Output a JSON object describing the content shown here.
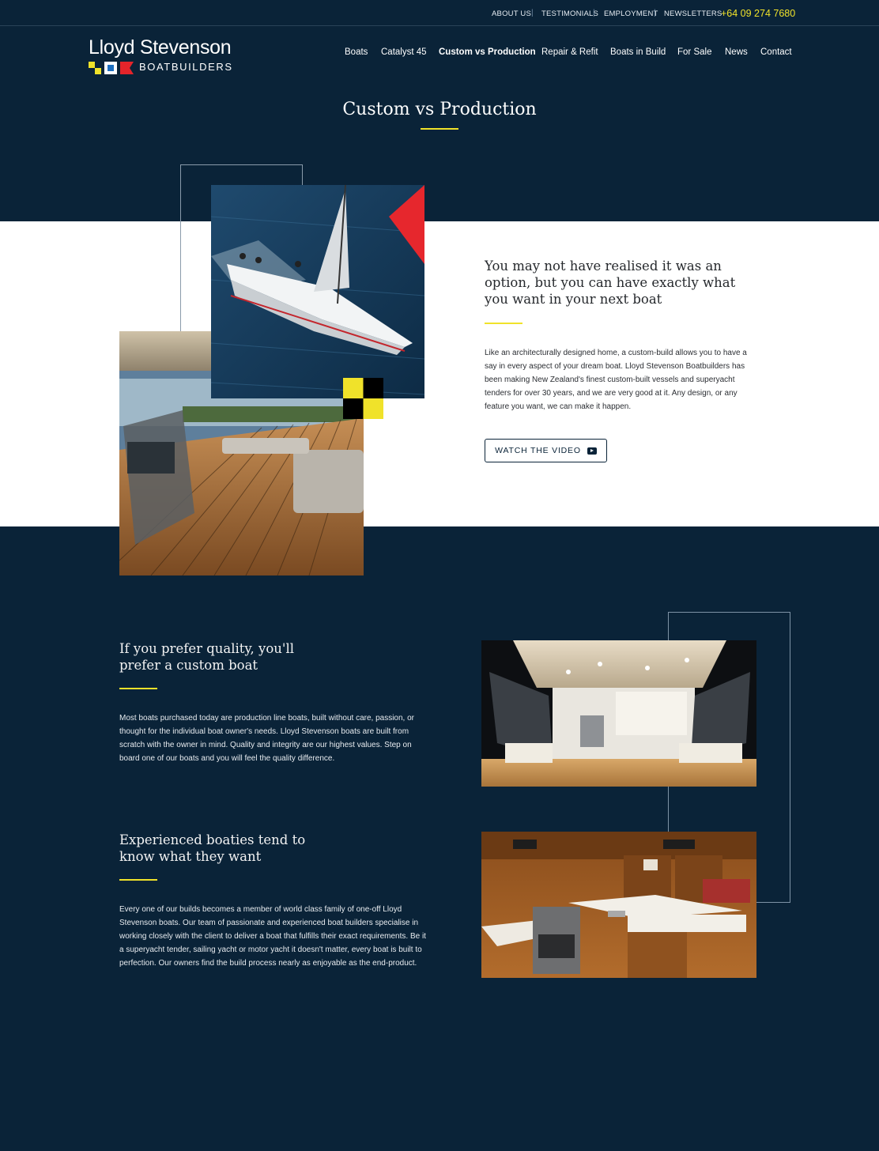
{
  "topbar": {
    "links": [
      "ABOUT US",
      "TESTIMONIALS",
      "EMPLOYMENT",
      "NEWSLETTERS"
    ],
    "phone": "+64 09 274 7680"
  },
  "logo": {
    "name": "Lloyd Stevenson",
    "sub": "BOATBUILDERS"
  },
  "nav": [
    "Boats",
    "Catalyst 45",
    "Custom vs Production",
    "Repair & Refit",
    "Boats in Build",
    "For Sale",
    "News",
    "Contact"
  ],
  "page": {
    "title": "Custom vs Production"
  },
  "intro": {
    "heading": "You may not have realised it was an option, but you can have exactly what you want in your next boat",
    "body": "Like an architecturally designed home, a custom-build allows you to have a say in every aspect of your dream boat. Lloyd Stevenson Boatbuilders has been making New Zealand's finest custom-built vessels and superyacht tenders for over 30 years, and we are very good at it. Any design, or any feature you want, we can make it happen.",
    "button": "WATCH THE VIDEO"
  },
  "quality": {
    "heading": "If you prefer quality, you'll prefer a custom boat",
    "body": "Most boats purchased today are production line boats, built without care, passion, or thought for the individual boat owner's needs. Lloyd Stevenson boats are built from scratch with the owner in mind. Quality and integrity are our highest values. Step on board one of our boats and you will feel the quality difference."
  },
  "experienced": {
    "heading": "Experienced boaties tend to know what they want",
    "body": "Every one of our builds becomes a member of world class family of one-off Lloyd Stevenson boats. Our team of passionate and experienced boat builders specialise in working closely with the client to deliver a boat that fulfills their exact requirements. Be it a  superyacht tender, sailing yacht or motor yacht it doesn't matter, every boat is built to perfection. Our owners find the build process nearly as enjoyable as the end-product."
  },
  "colors": {
    "navy": "#0a2338",
    "accent": "#f0e22a",
    "white": "#ffffff"
  }
}
